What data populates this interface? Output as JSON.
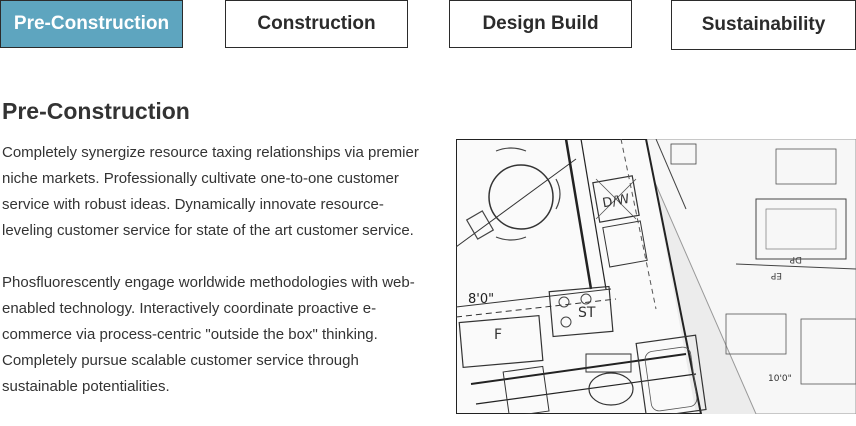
{
  "tabs": [
    {
      "label": "Pre-Construction",
      "active": true
    },
    {
      "label": "Construction",
      "active": false
    },
    {
      "label": "Design Build",
      "active": false
    },
    {
      "label": "Sustainability",
      "active": false
    }
  ],
  "content": {
    "title": "Pre-Construction",
    "paragraph_1": "Completely synergize resource taxing relationships via premier niche markets. Professionally cultivate one-to-one customer service with robust ideas. Dynamically innovate resource-leveling customer service for state of the art customer service.",
    "paragraph_2": "Phosfluorescently engage worldwide methodologies with web-enabled technology. Interactively coordinate proactive e-commerce via process-centric \"outside the box\" thinking. Completely pursue scalable customer service through sustainable potentialities."
  },
  "image": {
    "labels": {
      "dw": "D/W",
      "dim": "8'0\"",
      "st": "ST",
      "f": "F",
      "dp": "DP",
      "ep": "EP",
      "dim2": "10'0\""
    }
  },
  "colors": {
    "active_tab": "#5ea5bf",
    "border": "#2b2b2b",
    "text": "#333333"
  }
}
